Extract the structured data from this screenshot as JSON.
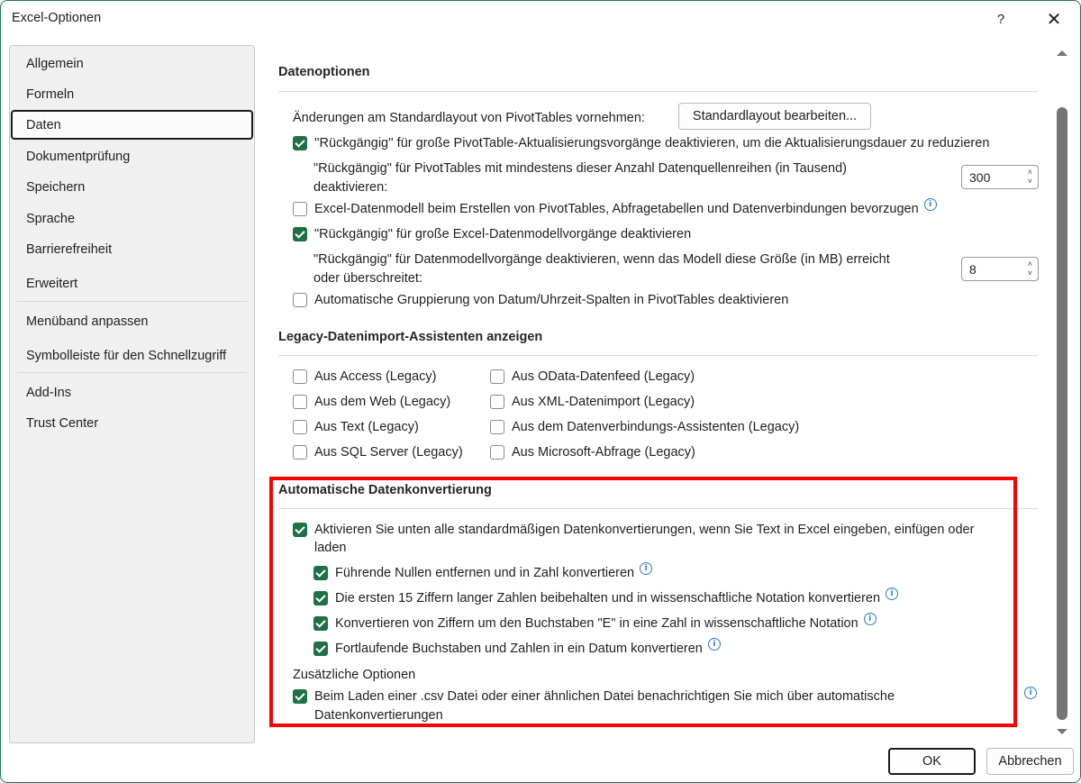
{
  "window": {
    "title": "Excel-Optionen",
    "help_label": "?",
    "close_label": "✕"
  },
  "sidebar": {
    "items": [
      {
        "label": "Allgemein",
        "active": false
      },
      {
        "label": "Formeln",
        "active": false
      },
      {
        "label": "Daten",
        "active": true
      },
      {
        "label": "Dokumentprüfung",
        "active": false
      },
      {
        "label": "Speichern",
        "active": false
      },
      {
        "label": "Sprache",
        "active": false
      },
      {
        "label": "Barrierefreiheit",
        "active": false
      },
      {
        "label": "Erweitert",
        "active": false
      },
      {
        "label": "Menüband anpassen",
        "active": false
      },
      {
        "label": "Symbolleiste für den Schnellzugriff",
        "active": false
      },
      {
        "label": "Add-Ins",
        "active": false
      },
      {
        "label": "Trust Center",
        "active": false
      }
    ]
  },
  "datenoptionen": {
    "title": "Datenoptionen",
    "layout_label": "Änderungen am Standardlayout von PivotTables vornehmen:",
    "layout_button": "Standardlayout bearbeiten...",
    "opt_undo_pivot": {
      "label": "''Rückgängig'' für große PivotTable-Aktualisierungsvorgänge deaktivieren, um die Aktualisierungsdauer zu reduzieren",
      "checked": true
    },
    "undo_pivot_rows_label_1": "\"Rückgängig\" für PivotTables mit mindestens dieser Anzahl Datenquellenreihen (in Tausend)",
    "undo_pivot_rows_label_2": "deaktivieren:",
    "undo_pivot_rows_value": "300",
    "opt_prefer_model": {
      "label": "Excel-Datenmodell beim Erstellen von PivotTables, Abfragetabellen und Datenverbindungen bevorzugen",
      "checked": false
    },
    "opt_undo_model": {
      "label": "\"Rückgängig\" für große Excel-Datenmodellvorgänge deaktivieren",
      "checked": true
    },
    "undo_model_size_label_1": "\"Rückgängig\" für Datenmodellvorgänge deaktivieren, wenn das Modell diese Größe (in MB) erreicht",
    "undo_model_size_label_2": "oder überschreitet:",
    "undo_model_size_value": "8",
    "opt_auto_group": {
      "label": "Automatische Gruppierung von Datum/Uhrzeit-Spalten in PivotTables deaktivieren",
      "checked": false
    }
  },
  "legacy": {
    "title": "Legacy-Datenimport-Assistenten anzeigen",
    "items": [
      {
        "label": "Aus Access (Legacy)",
        "checked": false
      },
      {
        "label": "Aus dem Web (Legacy)",
        "checked": false
      },
      {
        "label": "Aus Text (Legacy)",
        "checked": false
      },
      {
        "label": "Aus SQL Server (Legacy)",
        "checked": false
      },
      {
        "label": "Aus OData-Datenfeed (Legacy)",
        "checked": false
      },
      {
        "label": "Aus XML-Datenimport (Legacy)",
        "checked": false
      },
      {
        "label": "Aus dem Datenverbindungs-Assistenten (Legacy)",
        "checked": false
      },
      {
        "label": "Aus Microsoft-Abfrage (Legacy)",
        "checked": false
      }
    ]
  },
  "autoconvert": {
    "title": "Automatische Datenkonvertierung",
    "enable_all_1": "Aktivieren Sie unten alle standardmäßigen Datenkonvertierungen, wenn Sie Text in Excel eingeben, einfügen oder",
    "enable_all_2": "laden",
    "enable_all_checked": true,
    "sub_items": [
      {
        "label": "Führende Nullen entfernen und in Zahl konvertieren",
        "checked": true
      },
      {
        "label": "Die ersten 15 Ziffern langer Zahlen beibehalten und in wissenschaftliche Notation konvertieren",
        "checked": true
      },
      {
        "label": "Konvertieren von Ziffern um den Buchstaben \"E\" in eine Zahl in wissenschaftliche Notation",
        "checked": true
      },
      {
        "label": "Fortlaufende Buchstaben und Zahlen in ein Datum konvertieren",
        "checked": true
      }
    ],
    "additional_title": "Zusätzliche Optionen",
    "csv_notify_1": "Beim Laden einer .csv Datei oder einer ähnlichen Datei benachrichtigen Sie mich über automatische",
    "csv_notify_2": "Datenkonvertierungen",
    "csv_notify_checked": true
  },
  "footer": {
    "ok_label": "OK",
    "cancel_label": "Abbrechen"
  },
  "colors": {
    "accent": "#1e7145",
    "highlight": "#ff0000",
    "info": "#2a7bd6"
  }
}
